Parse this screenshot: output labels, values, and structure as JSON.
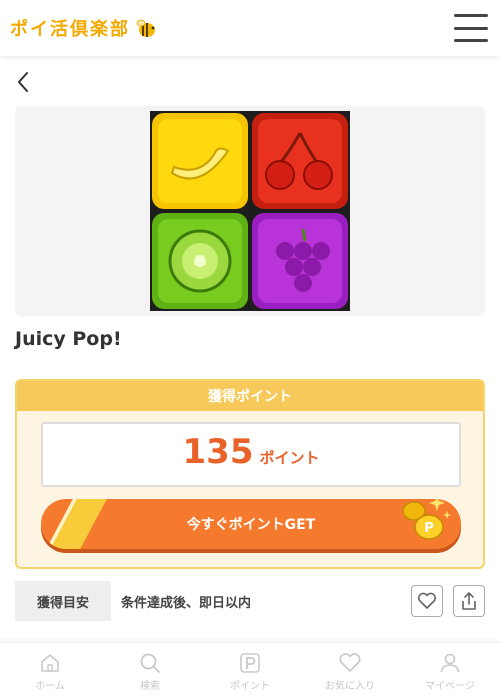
{
  "header": {
    "logo_text": "ポイ活倶楽部",
    "logo_icon": "bee-icon",
    "menu_icon": "hamburger-menu-icon"
  },
  "nav": {
    "back_icon": "chevron-left-icon"
  },
  "app": {
    "title": "Juicy Pop!",
    "icon": "fruit-puzzle-app-icon"
  },
  "points": {
    "header_label": "獲得ポイント",
    "value": "135",
    "unit": "ポイント",
    "cta_label": "今すぐポイントGET",
    "accent_color": "#f57a2e"
  },
  "estimate": {
    "label": "獲得目安",
    "value": "条件達成後、即日以内"
  },
  "actions": {
    "favorite_icon": "heart-icon",
    "share_icon": "share-icon"
  },
  "tabbar": {
    "items": [
      {
        "label": "ホーム",
        "icon": "home-icon"
      },
      {
        "label": "検索",
        "icon": "search-icon"
      },
      {
        "label": "ポイント",
        "icon": "point-icon"
      },
      {
        "label": "お気に入り",
        "icon": "heart-icon"
      },
      {
        "label": "マイページ",
        "icon": "user-icon"
      }
    ]
  }
}
